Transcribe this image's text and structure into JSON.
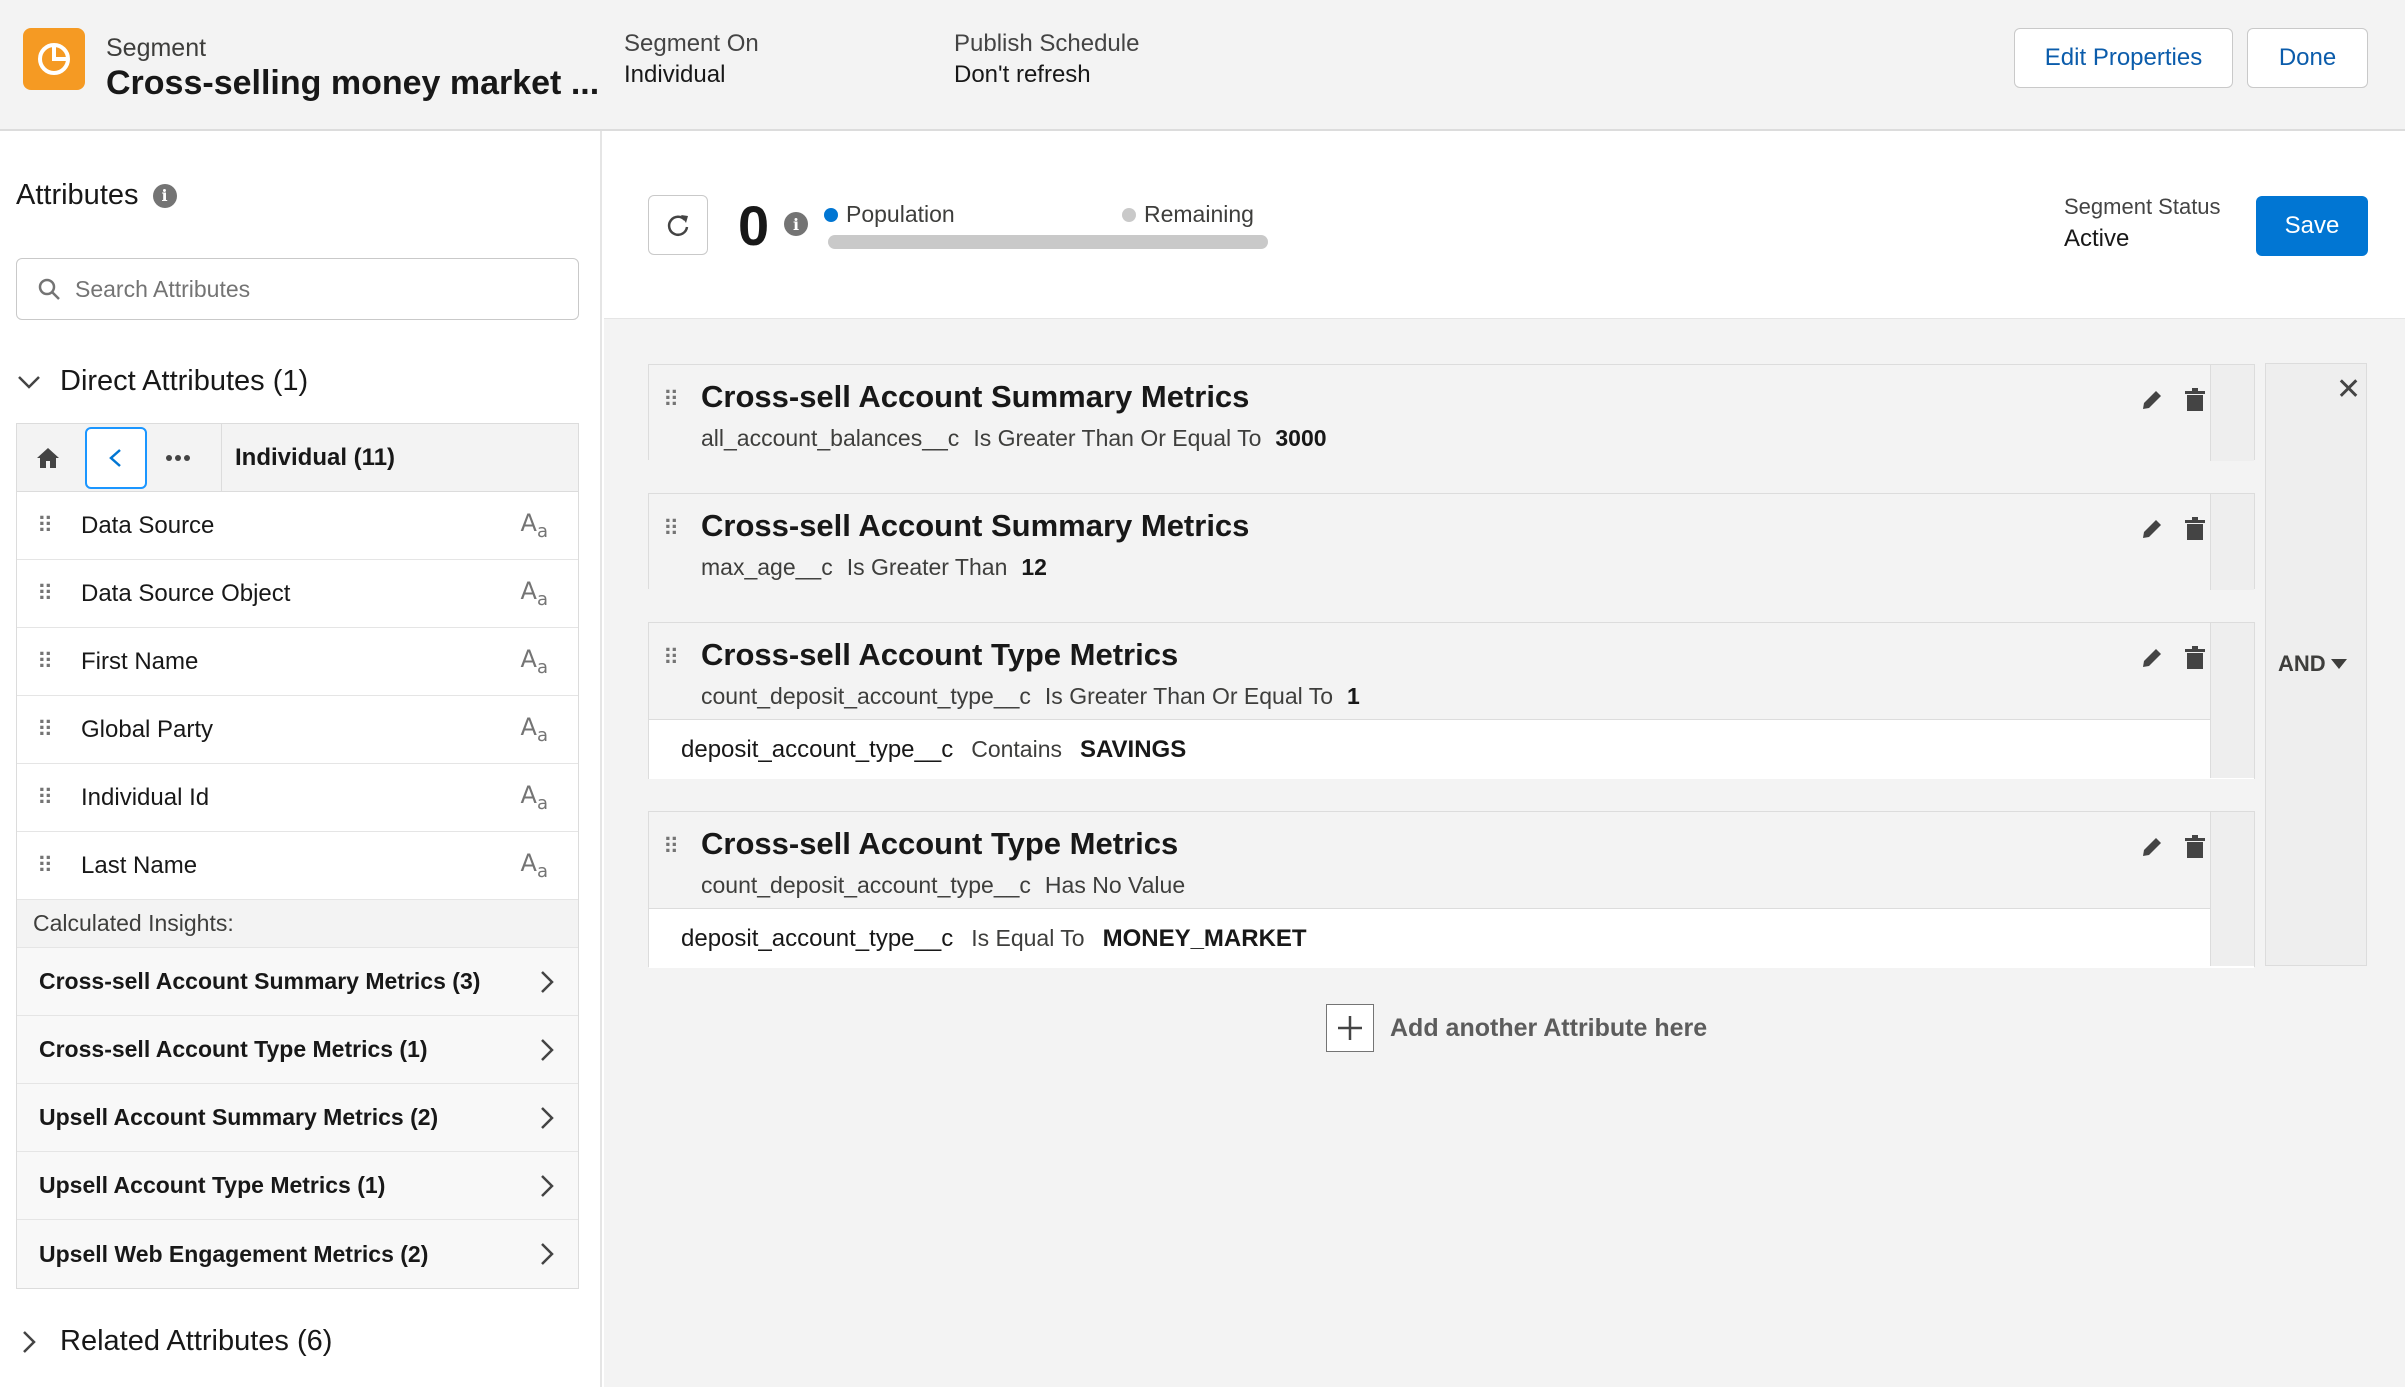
{
  "header": {
    "subtitle": "Segment",
    "title": "Cross-selling money market ...",
    "segment_on_label": "Segment On",
    "segment_on_value": "Individual",
    "publish_label": "Publish Schedule",
    "publish_value": "Don't refresh",
    "edit_properties": "Edit Properties",
    "done": "Done"
  },
  "left": {
    "title": "Attributes",
    "search_placeholder": "Search Attributes",
    "direct": "Direct Attributes (1)",
    "nav_label": "Individual (11)",
    "attributes": [
      "Data Source",
      "Data Source Object",
      "First Name",
      "Global Party",
      "Individual Id",
      "Last Name"
    ],
    "calc_header": "Calculated Insights:",
    "insights": [
      "Cross-sell Account Summary Metrics (3)",
      "Cross-sell Account Type Metrics (1)",
      "Upsell Account Summary Metrics (2)",
      "Upsell Account Type Metrics (1)",
      "Upsell Web Engagement Metrics (2)"
    ],
    "related": "Related Attributes (6)"
  },
  "topbar": {
    "count": "0",
    "population": "Population",
    "remaining": "Remaining",
    "status_label": "Segment Status",
    "status_value": "Active",
    "save": "Save"
  },
  "rules": [
    {
      "title": "Cross-sell Account Summary Metrics",
      "field": "all_account_balances__c",
      "op": "Is Greater Than Or Equal To",
      "value": "3000"
    },
    {
      "title": "Cross-sell Account Summary Metrics",
      "field": "max_age__c",
      "op": "Is Greater Than",
      "value": "12"
    },
    {
      "title": "Cross-sell Account Type Metrics",
      "field": "count_deposit_account_type__c",
      "op": "Is Greater Than Or Equal To",
      "value": "1",
      "sub": {
        "field": "deposit_account_type__c",
        "op": "Contains",
        "value": "SAVINGS"
      }
    },
    {
      "title": "Cross-sell Account Type Metrics",
      "field": "count_deposit_account_type__c",
      "op": "Has No Value",
      "value": "",
      "sub": {
        "field": "deposit_account_type__c",
        "op": "Is Equal To",
        "value": "MONEY_MARKET"
      }
    }
  ],
  "logic": "AND",
  "add_attribute": "Add another Attribute here",
  "colors": {
    "accent": "#0176d3",
    "app_icon": "#f59a23",
    "population_dot": "#0176d3",
    "remaining_dot": "#c9c9c9"
  }
}
